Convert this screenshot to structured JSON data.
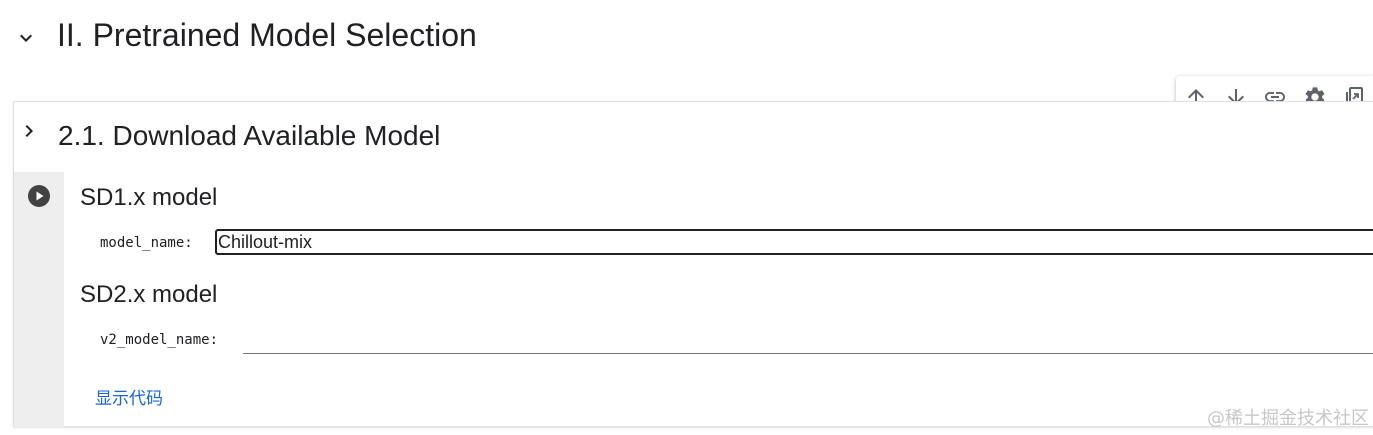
{
  "section": {
    "title": "II. Pretrained Model Selection",
    "chevron_icon": "chevron-down-icon"
  },
  "cell": {
    "subsection_title": "2.1. Download Available Model",
    "subsection_chevron_icon": "chevron-right-icon",
    "run_icon": "play-circle-icon",
    "sd1": {
      "heading": "SD1.x model",
      "label": "model_name:",
      "value": "Chillout-mix"
    },
    "sd2": {
      "heading": "SD2.x model",
      "label": "v2_model_name:",
      "value": ""
    },
    "show_code_label": "显示代码"
  },
  "toolbar": {
    "icons": [
      "arrow-up-icon",
      "arrow-down-icon",
      "link-icon",
      "gear-icon",
      "mirror-cell-icon"
    ]
  },
  "watermark": "@稀土掘金技术社区",
  "colors": {
    "link": "#1967d2",
    "gutter": "#eeeeee",
    "icon": "#5f6368",
    "text": "#202124"
  }
}
